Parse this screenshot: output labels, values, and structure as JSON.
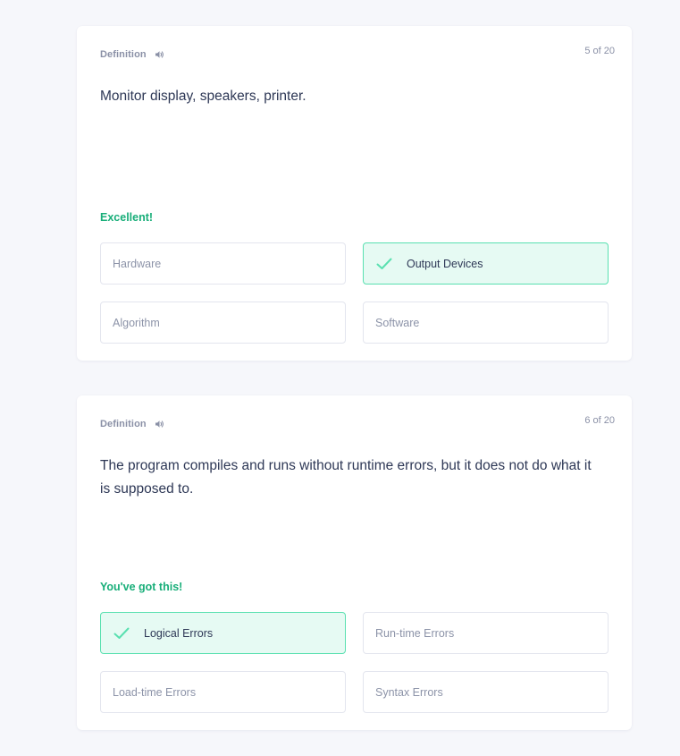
{
  "colors": {
    "page_background": "#f6f7fb",
    "card_background": "#ffffff",
    "success_text": "#18ae79",
    "correct_option_background": "#e6faf3",
    "correct_option_border": "#59e0b0",
    "muted_text": "#8a90a6",
    "primary_text": "#2e3856"
  },
  "questions": [
    {
      "term_label": "Definition",
      "audio_icon": "speaker-icon",
      "counter": "5 of 20",
      "prompt": "Monitor display, speakers, printer.",
      "feedback": "Excellent!",
      "options": [
        {
          "label": "Hardware",
          "state": "default"
        },
        {
          "label": "Output Devices",
          "state": "correct"
        },
        {
          "label": "Algorithm",
          "state": "default"
        },
        {
          "label": "Software",
          "state": "default"
        }
      ]
    },
    {
      "term_label": "Definition",
      "audio_icon": "speaker-icon",
      "counter": "6 of 20",
      "prompt": "The program compiles and runs without runtime errors, but it does not do what it is supposed to.",
      "feedback": "You've got this!",
      "options": [
        {
          "label": "Logical Errors",
          "state": "correct"
        },
        {
          "label": "Run-time Errors",
          "state": "default"
        },
        {
          "label": "Load-time Errors",
          "state": "default"
        },
        {
          "label": "Syntax Errors",
          "state": "default"
        }
      ]
    }
  ]
}
